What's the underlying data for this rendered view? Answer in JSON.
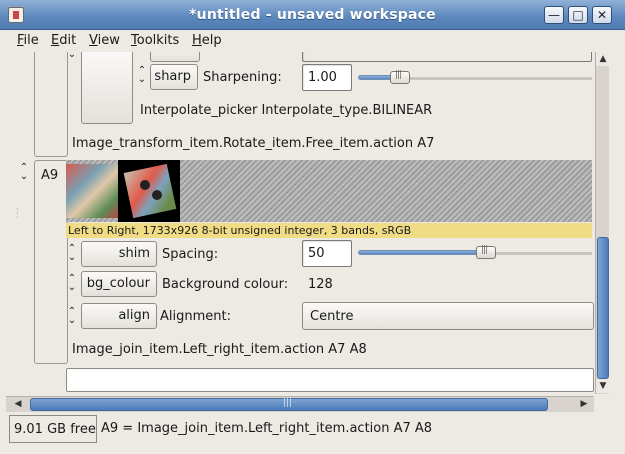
{
  "window": {
    "title": "*untitled - unsaved workspace",
    "controls": {
      "minimize": "—",
      "maximize": "□",
      "close": "✕"
    }
  },
  "menu": [
    {
      "key": "F",
      "rest": "ile"
    },
    {
      "key": "E",
      "rest": "dit"
    },
    {
      "key": "V",
      "rest": "iew"
    },
    {
      "key": "T",
      "rest": "oolkits"
    },
    {
      "key": "H",
      "rest": "elp"
    }
  ],
  "upper_item": {
    "sharp_button": "sharp",
    "sharpening_label": "Sharpening:",
    "sharpening_value": "1.00",
    "sharpening_slider_fraction": 0.18,
    "interpolate_text": "Interpolate_picker Interpolate_type.BILINEAR",
    "action_text": "Image_transform_item.Rotate_item.Free_item.action A7"
  },
  "row_a9": {
    "name": "A9",
    "caption": "Left to Right, 1733x926 8-bit unsigned integer, 3 bands, sRGB",
    "shim_button": "shim",
    "spacing_label": "Spacing:",
    "spacing_value": "50",
    "spacing_slider_fraction": 0.55,
    "bg_button": "bg_colour",
    "background_label": "Background colour:",
    "background_value": "128",
    "align_button": "align",
    "alignment_label": "Alignment:",
    "alignment_value": "Centre",
    "action_text": "Image_join_item.Left_right_item.action A7 A8"
  },
  "status": {
    "free_space": "9.01 GB free",
    "message": "A9 = Image_join_item.Left_right_item.action A7 A8"
  },
  "icons": {
    "spin": "spin-arrows-icon",
    "scroll_up": "arrow-up-icon",
    "scroll_down": "arrow-down-icon",
    "scroll_left": "arrow-left-icon",
    "scroll_right": "arrow-right-icon"
  }
}
